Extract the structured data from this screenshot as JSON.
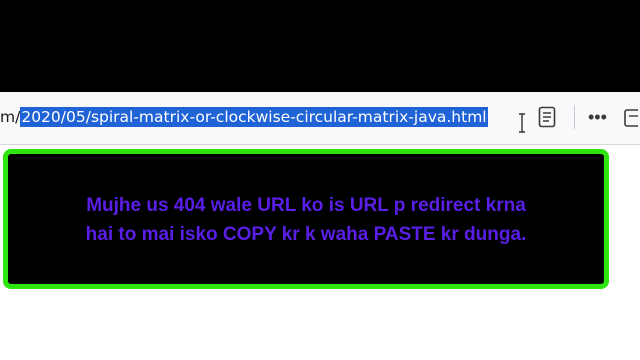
{
  "address_bar": {
    "url_prefix": "m/",
    "url_selected": "2020/05/spiral-matrix-or-clockwise-circular-matrix-java.html"
  },
  "toolbar": {
    "reader_icon": "reader-view-icon",
    "menu_label": "•••",
    "edge_icon": "toolbar-icon"
  },
  "overlay": {
    "line1": "Mujhe us 404 wale URL ko is URL p redirect krna",
    "line2": "hai to mai isko COPY kr k waha PASTE kr dunga."
  },
  "colors": {
    "selection": "#1f63d6",
    "overlay_border": "#2ee50f",
    "overlay_text": "#5a1fe6"
  }
}
